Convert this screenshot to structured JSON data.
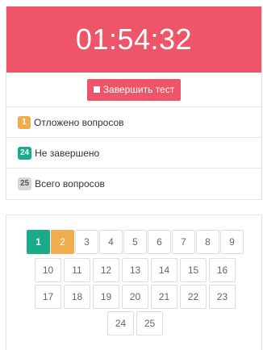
{
  "timer": {
    "value": "01:54:32"
  },
  "finish_button": {
    "label": "Завершить тест"
  },
  "stats": [
    {
      "count": "1",
      "label": "Отложено вопросов",
      "color": "#f0ad4e"
    },
    {
      "count": "24",
      "label": "Не завершено",
      "color": "#1aab8b"
    },
    {
      "count": "25",
      "label": "Всего вопросов",
      "color": "#d4d8dc"
    }
  ],
  "questions": [
    {
      "number": "1",
      "state": "answered"
    },
    {
      "number": "2",
      "state": "postponed"
    },
    {
      "number": "3",
      "state": "open"
    },
    {
      "number": "4",
      "state": "open"
    },
    {
      "number": "5",
      "state": "open"
    },
    {
      "number": "6",
      "state": "open"
    },
    {
      "number": "7",
      "state": "open"
    },
    {
      "number": "8",
      "state": "open"
    },
    {
      "number": "9",
      "state": "open"
    },
    {
      "number": "10",
      "state": "open"
    },
    {
      "number": "11",
      "state": "open"
    },
    {
      "number": "12",
      "state": "open"
    },
    {
      "number": "13",
      "state": "open"
    },
    {
      "number": "14",
      "state": "open"
    },
    {
      "number": "15",
      "state": "open"
    },
    {
      "number": "16",
      "state": "open"
    },
    {
      "number": "17",
      "state": "open"
    },
    {
      "number": "18",
      "state": "open"
    },
    {
      "number": "19",
      "state": "open"
    },
    {
      "number": "20",
      "state": "open"
    },
    {
      "number": "21",
      "state": "open"
    },
    {
      "number": "22",
      "state": "open"
    },
    {
      "number": "23",
      "state": "open"
    },
    {
      "number": "24",
      "state": "open"
    },
    {
      "number": "25",
      "state": "open"
    }
  ],
  "colors": {
    "accent": "#ee5568",
    "answered": "#1aab8b",
    "postponed": "#f0ad4e"
  }
}
